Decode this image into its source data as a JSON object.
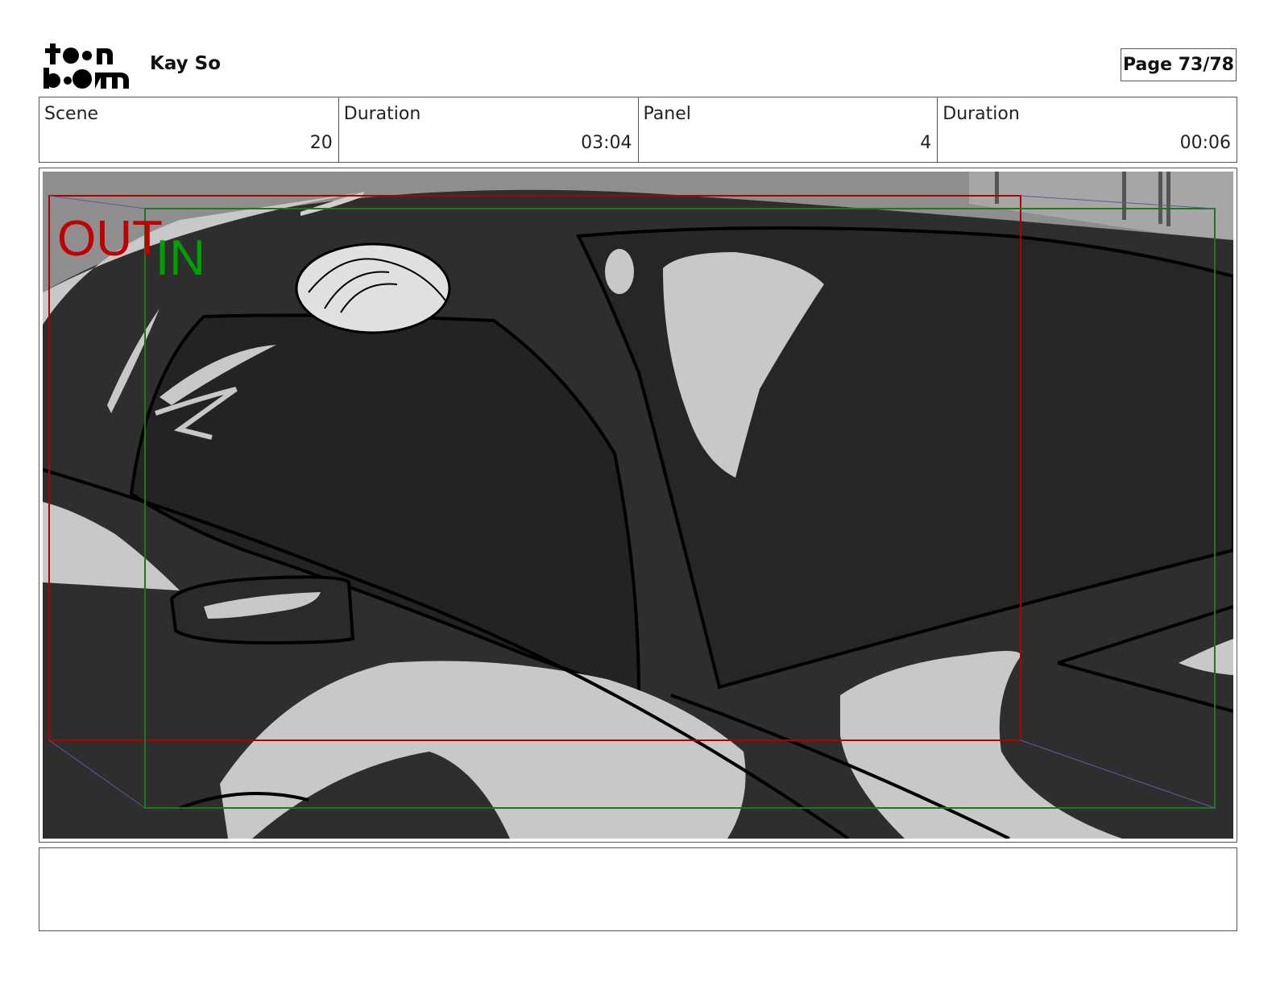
{
  "header": {
    "logo_icon": "toon-boom-logo",
    "logo_text": "toon boom",
    "author": "Kay So",
    "page_label": "Page 73/78"
  },
  "info": {
    "scene": {
      "label": "Scene",
      "value": "20"
    },
    "scene_duration": {
      "label": "Duration",
      "value": "03:04"
    },
    "panel": {
      "label": "Panel",
      "value": "4"
    },
    "panel_duration": {
      "label": "Duration",
      "value": "00:06"
    }
  },
  "panel_image": {
    "out_label": "OUT",
    "in_label": "IN",
    "out_color": "#c00000",
    "in_color": "#00a000"
  },
  "notes": {
    "text": ""
  }
}
